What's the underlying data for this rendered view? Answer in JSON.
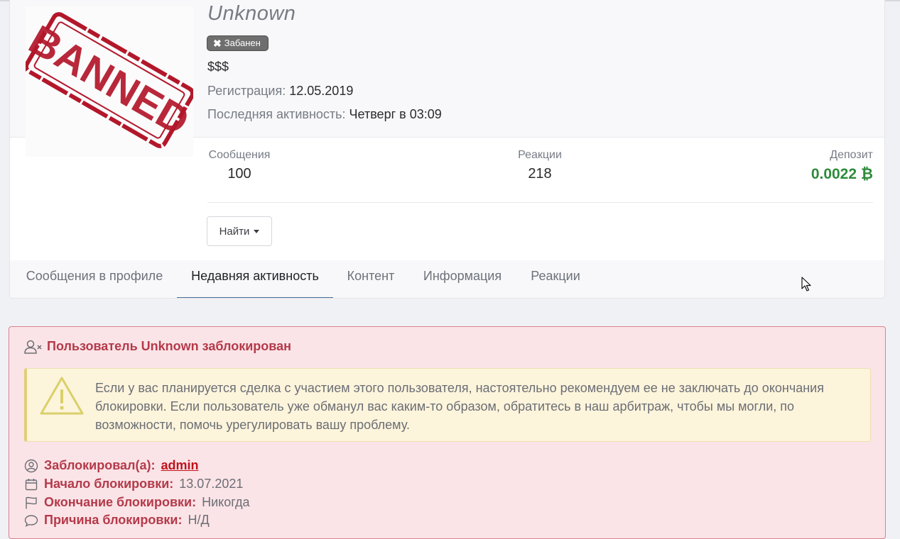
{
  "profile": {
    "username": "Unknown",
    "badge": "Забанен",
    "user_title": "$$$",
    "registration_label": "Регистрация:",
    "registration_value": "12.05.2019",
    "last_activity_label": "Последняя активность:",
    "last_activity_value": "Четверг в 03:09",
    "avatar_stamp_text": "BANNED"
  },
  "stats": {
    "messages_label": "Сообщения",
    "messages_value": "100",
    "reactions_label": "Реакции",
    "reactions_value": "218",
    "deposit_label": "Депозит",
    "deposit_value": "0.0022 ₿"
  },
  "find_button": "Найти",
  "tabs": [
    {
      "label": "Сообщения в профиле"
    },
    {
      "label": "Недавняя активность",
      "active": true
    },
    {
      "label": "Контент"
    },
    {
      "label": "Информация"
    },
    {
      "label": "Реакции"
    }
  ],
  "ban_notice": {
    "title": "Пользователь Unknown заблокирован",
    "warning": "Если у вас планируется сделка с участием этого пользователя, настоятельно рекомендуем ее не заключать до окончания блокировки. Если пользователь уже обманул вас каким-то образом, обратитесь в наш арбитраж, чтобы мы могли, по возможности, помочь урегулировать вашу проблему.",
    "banned_by_label": "Заблокировал(а):",
    "banned_by_value": "admin",
    "start_label": "Начало блокировки:",
    "start_value": "13.07.2021",
    "end_label": "Окончание блокировки:",
    "end_value": "Никогда",
    "reason_label": "Причина блокировки:",
    "reason_value": "Н/Д"
  },
  "colors": {
    "deposit_green": "#2e8b3a",
    "danger_red": "#b43a4a",
    "tab_underline": "#4a6d92",
    "notice_bg": "#fbe4e7",
    "warning_bg": "#fdf4dc"
  }
}
